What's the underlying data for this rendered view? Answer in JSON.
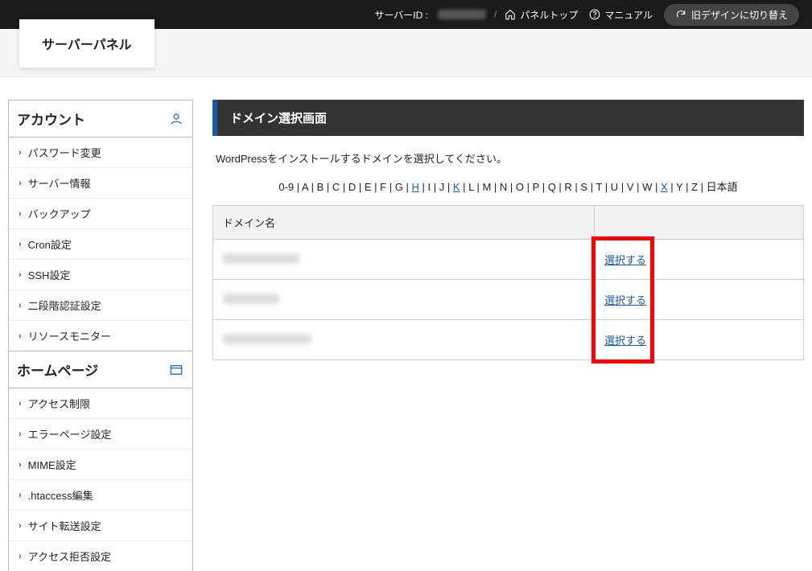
{
  "topbar": {
    "server_id_label": "サーバーID :",
    "panel_top": "パネルトップ",
    "manual": "マニュアル",
    "old_design": "旧デザインに切り替え"
  },
  "logo": "サーバーパネル",
  "sidebar": {
    "sections": [
      {
        "title": "アカウント",
        "icon": "user",
        "items": [
          "パスワード変更",
          "サーバー情報",
          "バックアップ",
          "Cron設定",
          "SSH設定",
          "二段階認証設定",
          "リソースモニター"
        ]
      },
      {
        "title": "ホームページ",
        "icon": "window",
        "items": [
          "アクセス制限",
          "エラーページ設定",
          "MIME設定",
          ".htaccess編集",
          "サイト転送設定",
          "アクセス拒否設定"
        ]
      }
    ]
  },
  "main": {
    "title": "ドメイン選択画面",
    "desc": "WordPressをインストールするドメインを選択してください。",
    "alpha": "0-9 | A | B | C | D | E | F | G | H | I | J | K | L | M | N | O | P | Q | R | S | T | U | V | W | X | Y | Z | 日本語",
    "alpha_links": [
      "H",
      "K",
      "X"
    ],
    "table": {
      "header_domain": "ドメイン名",
      "select_label": "選択する",
      "rows": 3
    }
  }
}
